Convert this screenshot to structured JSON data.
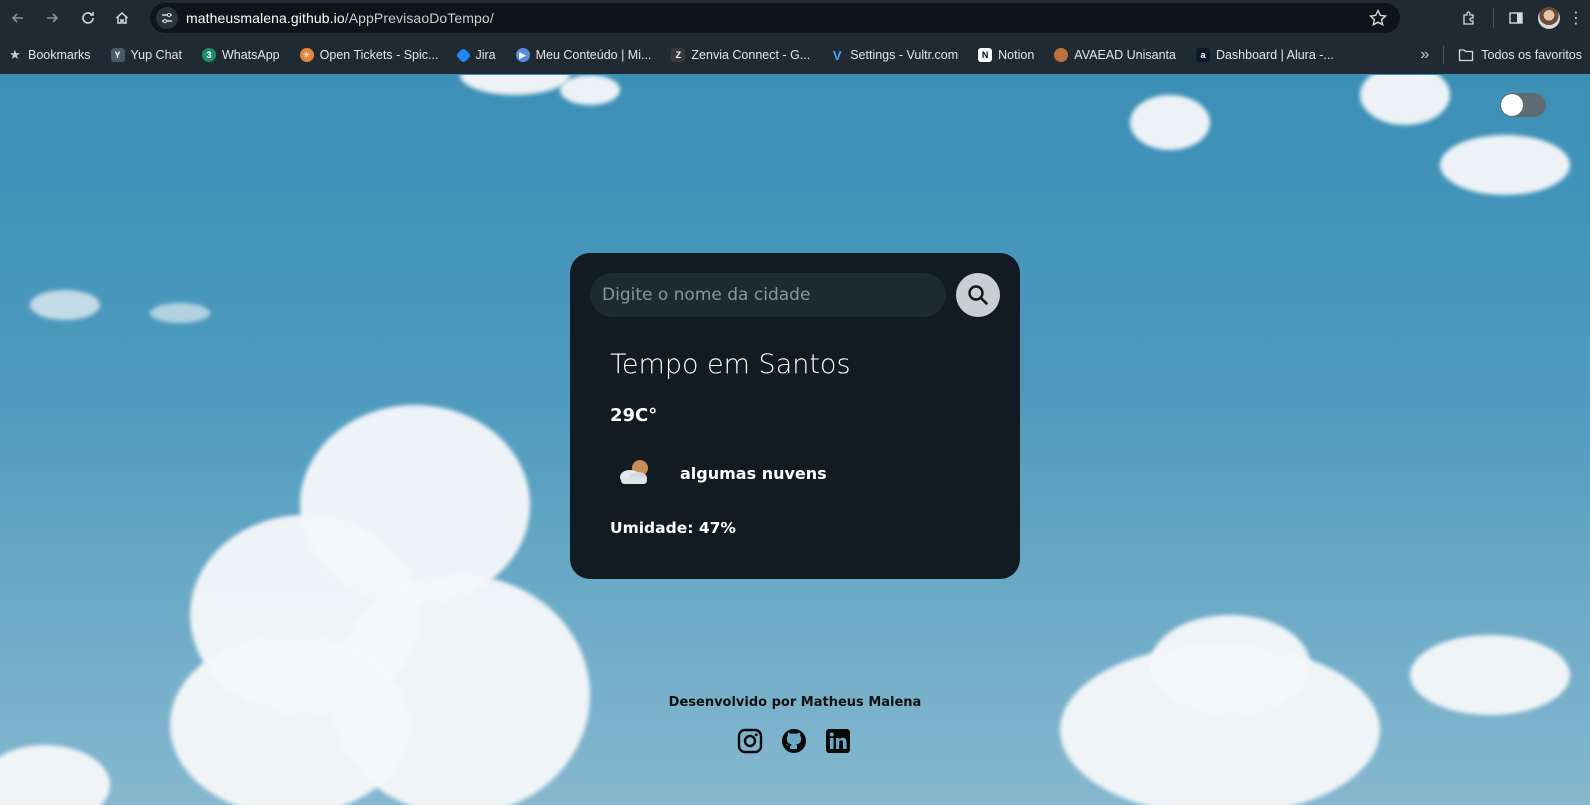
{
  "browser": {
    "url_host": "matheusmalena.github.io",
    "url_path": "/AppPrevisaoDoTempo/",
    "bookmarks": [
      {
        "label": "Bookmarks",
        "icon": "star-icon",
        "color": "#c7ccd1"
      },
      {
        "label": "Yup Chat",
        "icon": "yup-chat-icon",
        "color": "#4a5a6a"
      },
      {
        "label": "WhatsApp",
        "icon": "whatsapp-icon",
        "color": "#25d366"
      },
      {
        "label": "Open Tickets - Spic...",
        "icon": "tickets-icon",
        "color": "#e2873b"
      },
      {
        "label": "Jira",
        "icon": "jira-icon",
        "color": "#2684ff"
      },
      {
        "label": "Meu Conteúdo | Mi...",
        "icon": "play-icon",
        "color": "#5a8bd8"
      },
      {
        "label": "Zenvia Connect - G...",
        "icon": "zenvia-icon",
        "color": "#3a3a3a"
      },
      {
        "label": "Settings - Vultr.com",
        "icon": "vultr-icon",
        "color": "#2f7bd9"
      },
      {
        "label": "Notion",
        "icon": "notion-icon",
        "color": "#ffffff"
      },
      {
        "label": "AVAEAD Unisanta",
        "icon": "avaead-icon",
        "color": "#c0703d"
      },
      {
        "label": "Dashboard | Alura -...",
        "icon": "alura-icon",
        "color": "#0a1a2a"
      }
    ],
    "bookmarks_overflow": "»",
    "all_bookmarks_label": "Todos os favoritos"
  },
  "app": {
    "search_placeholder": "Digite o nome da cidade",
    "city_title": "Tempo em Santos",
    "temperature": "29C°",
    "description": "algumas nuvens",
    "weather_icon": "few-clouds-icon",
    "humidity_label": "Umidade: ",
    "humidity_value": "47%",
    "theme_toggle_on": false
  },
  "footer": {
    "credit": "Desenvolvido por Matheus Malena",
    "socials": [
      "instagram-icon",
      "github-icon",
      "linkedin-icon"
    ]
  },
  "colors": {
    "card_bg": "#111b21",
    "input_bg": "#1e2a31",
    "search_button_bg": "#c9ced2",
    "chrome_bg": "#1f2a33"
  }
}
